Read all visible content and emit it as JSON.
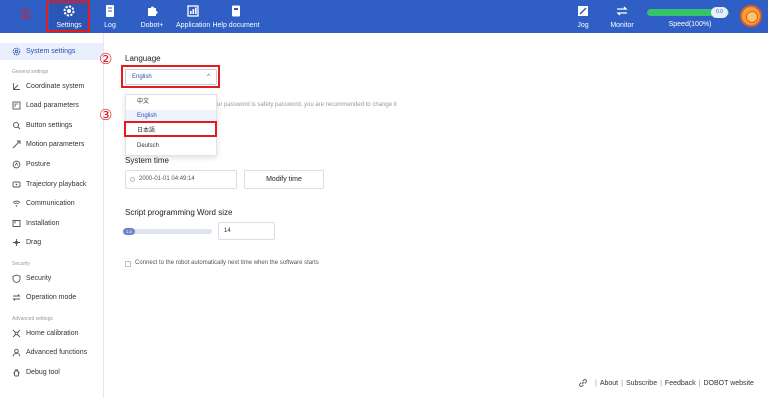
{
  "topnav": [
    {
      "key": "settings",
      "label": "Settings",
      "icon": "gear-icon",
      "active": true
    },
    {
      "key": "log",
      "label": "Log",
      "icon": "log-icon"
    },
    {
      "key": "dobot_plus",
      "label": "Dobot+",
      "icon": "puzzle-icon"
    },
    {
      "key": "application",
      "label": "Application",
      "icon": "chart-icon"
    },
    {
      "key": "help",
      "label": "Help document",
      "icon": "document-icon"
    }
  ],
  "toolbar_right": {
    "jog_label": "Jog",
    "monitor_label": "Monitor",
    "speed_label": "Speed(100%)",
    "speed_knob": "0.0",
    "speed_value": 100
  },
  "sidebar": {
    "active_item": "System settings",
    "top_item": "System settings",
    "group_general": "General settings",
    "general_items": [
      "Coordinate system",
      "Load parameters",
      "Button settings",
      "Motion parameters",
      "Posture",
      "Trajectory playback",
      "Communication",
      "Installation",
      "Drag"
    ],
    "group_security": "Security",
    "security_items": [
      "Security",
      "Operation mode"
    ],
    "group_advanced": "Advanced settings",
    "advanced_items": [
      "Home calibration",
      "Advanced functions",
      "Debug tool"
    ]
  },
  "language": {
    "title": "Language",
    "selected": "English",
    "chevron": "^",
    "options": [
      "中文",
      "English",
      "日本語",
      "Deutsch"
    ],
    "warning_fragment": "ur password is safety password, you are recommended to change it"
  },
  "system_time": {
    "title": "System time",
    "value": "2000-01-01 04:49:14",
    "modify_label": "Modify time"
  },
  "word_size": {
    "title": "Script programming Word size",
    "knob": "1.5",
    "value": "14"
  },
  "auto_connect": {
    "label": "Connect to the robot automatically next time when the software starts",
    "checked": false
  },
  "footer": {
    "links": [
      "About",
      "Subscribe",
      "Feedback",
      "DOBOT website"
    ]
  },
  "annotations": {
    "step1": "①",
    "step2": "②",
    "step3": "③",
    "color": "#e21b1b"
  },
  "colors": {
    "topbar": "#2f5fc4",
    "accent": "#2a4fb0",
    "speed_bar": "#34c26a"
  }
}
